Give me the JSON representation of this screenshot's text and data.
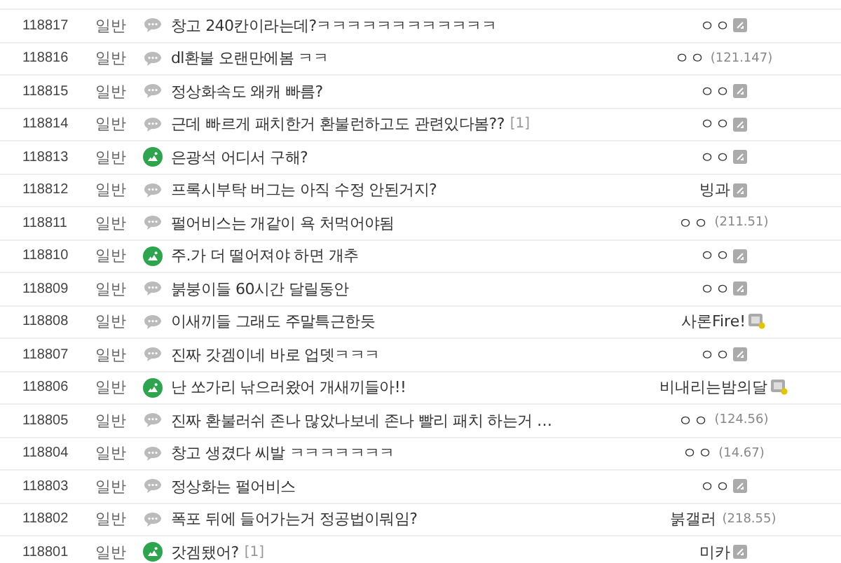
{
  "posts": [
    {
      "number": "118817",
      "category": "일반",
      "kind": "comment",
      "title": "창고 240칸이라는데?ㅋㅋㅋㅋㅋㅋㅋㅋㅋㅋㅋㅋ",
      "writer": {
        "name": "ㅇㅇ",
        "kind": "gallog"
      }
    },
    {
      "number": "118816",
      "category": "일반",
      "kind": "comment",
      "title": "dl환불 오랜만에봄 ㅋㅋ",
      "writer": {
        "name": "ㅇㅇ",
        "kind": "ip",
        "ip": "(121.147)"
      }
    },
    {
      "number": "118815",
      "category": "일반",
      "kind": "comment",
      "title": "정상화속도 왜캐 빠름?",
      "writer": {
        "name": "ㅇㅇ",
        "kind": "gallog"
      }
    },
    {
      "number": "118814",
      "category": "일반",
      "kind": "comment",
      "title": "근데 빠르게 패치한거 환불런하고도 관련있다봄??",
      "replies": "[1]",
      "writer": {
        "name": "ㅇㅇ",
        "kind": "gallog"
      }
    },
    {
      "number": "118813",
      "category": "일반",
      "kind": "image",
      "title": "은광석 어디서 구해?",
      "writer": {
        "name": "ㅇㅇ",
        "kind": "gallog"
      }
    },
    {
      "number": "118812",
      "category": "일반",
      "kind": "comment",
      "title": "프록시부탁 버그는 아직 수정 안된거지?",
      "writer": {
        "name": "빙과",
        "kind": "gallog"
      }
    },
    {
      "number": "118811",
      "category": "일반",
      "kind": "comment",
      "title": "펄어비스는 개같이 욕 처먹어야됨",
      "writer": {
        "name": "ㅇㅇ",
        "kind": "ip",
        "ip": "(211.51)"
      }
    },
    {
      "number": "118810",
      "category": "일반",
      "kind": "image",
      "title": "주.가 더 떨어져야 하면 개추",
      "writer": {
        "name": "ㅇㅇ",
        "kind": "gallog"
      }
    },
    {
      "number": "118809",
      "category": "일반",
      "kind": "comment",
      "title": "붉붕이들 60시간 달릴동안",
      "writer": {
        "name": "ㅇㅇ",
        "kind": "gallog"
      }
    },
    {
      "number": "118808",
      "category": "일반",
      "kind": "comment",
      "title": "이새끼들 그래도 주말특근한듯",
      "writer": {
        "name": "사론Fire!",
        "kind": "fixed"
      }
    },
    {
      "number": "118807",
      "category": "일반",
      "kind": "comment",
      "title": "진짜 갓겜이네 바로 업뎃ㅋㅋㅋ",
      "writer": {
        "name": "ㅇㅇ",
        "kind": "gallog"
      }
    },
    {
      "number": "118806",
      "category": "일반",
      "kind": "image",
      "title": "난 쏘가리 낚으러왔어 개새끼들아!!",
      "writer": {
        "name": "비내리는밤의달",
        "kind": "fixed"
      }
    },
    {
      "number": "118805",
      "category": "일반",
      "kind": "comment",
      "title": "진짜 환불러쉬 존나 많았나보네 존나 빨리 패치 하는거 …",
      "writer": {
        "name": "ㅇㅇ",
        "kind": "ip",
        "ip": "(124.56)"
      }
    },
    {
      "number": "118804",
      "category": "일반",
      "kind": "comment",
      "title": "창고 생겼다 씨발 ㅋㅋㅋㅋㅋㅋㅋ",
      "writer": {
        "name": "ㅇㅇ",
        "kind": "ip",
        "ip": "(14.67)"
      }
    },
    {
      "number": "118803",
      "category": "일반",
      "kind": "comment",
      "title": "정상화는 펄어비스",
      "writer": {
        "name": "ㅇㅇ",
        "kind": "gallog"
      }
    },
    {
      "number": "118802",
      "category": "일반",
      "kind": "comment",
      "title": "폭포 뒤에 들어가는거 정공법이뭐임?",
      "writer": {
        "name": "붉갤러",
        "kind": "ip",
        "ip": "(218.55)"
      }
    },
    {
      "number": "118801",
      "category": "일반",
      "kind": "image",
      "title": "갓겜됐어?",
      "replies": "[1]",
      "writer": {
        "name": "미카",
        "kind": "gallog"
      }
    }
  ]
}
